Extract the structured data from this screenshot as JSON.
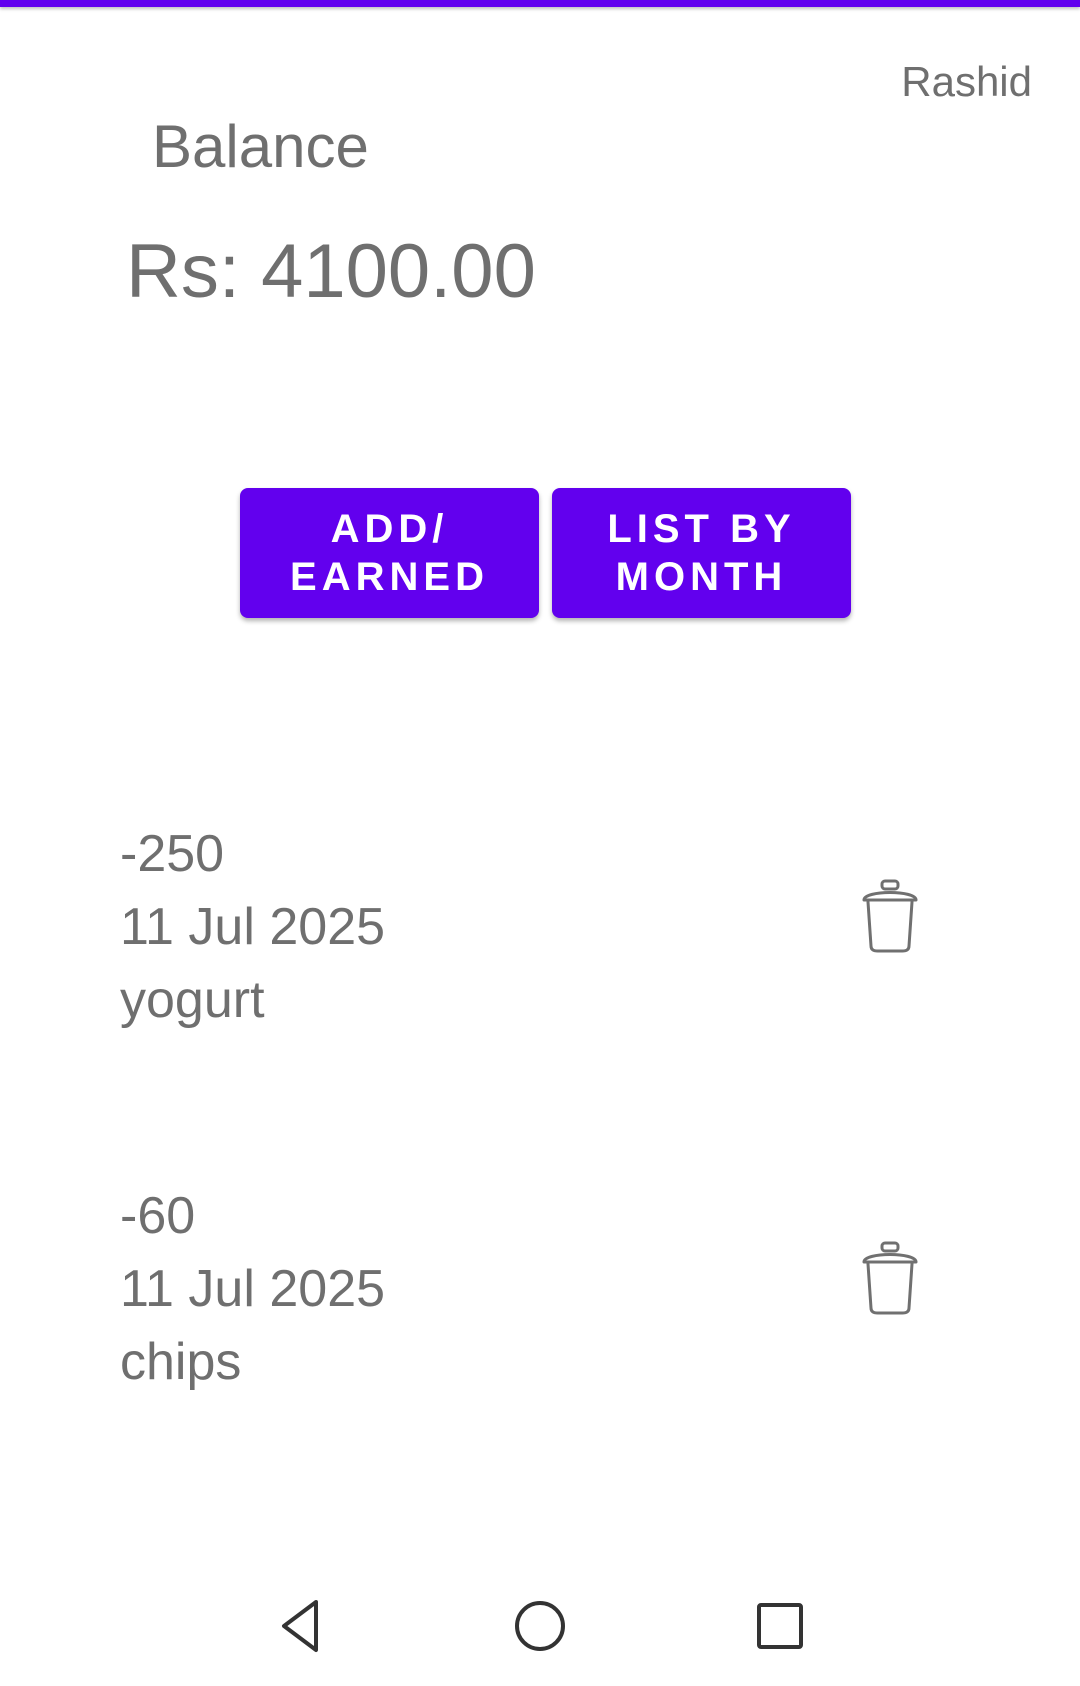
{
  "header": {
    "user_name": "Rashid",
    "balance_label": "Balance",
    "balance_amount": "Rs: 4100.00",
    "accent_color": "#6200EE"
  },
  "actions": {
    "add_earned_line1": "ADD/",
    "add_earned_line2": "EARNED",
    "list_by_month_line1": "LIST BY",
    "list_by_month_line2": "MONTH"
  },
  "transactions": [
    {
      "amount": "-250",
      "date": "11 Jul 2025",
      "note": "yogurt",
      "delete_icon": "trash-icon"
    },
    {
      "amount": "-60",
      "date": "11 Jul 2025",
      "note": "chips",
      "delete_icon": "trash-icon"
    }
  ],
  "navigation": {
    "back_icon": "triangle-back-icon",
    "home_icon": "circle-home-icon",
    "recent_icon": "square-recents-icon"
  }
}
